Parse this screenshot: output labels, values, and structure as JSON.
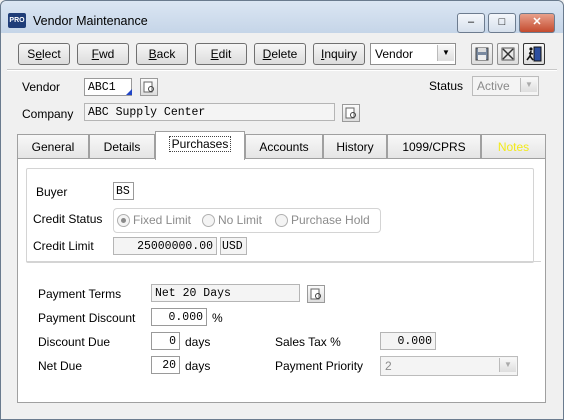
{
  "window": {
    "title": "Vendor Maintenance",
    "app_icon": "PRO",
    "minimize_glyph": "‒",
    "maximize_glyph": "□",
    "close_glyph": "✕"
  },
  "toolbar": {
    "buttons": [
      {
        "pre": "S",
        "u": "e",
        "post": "lect"
      },
      {
        "pre": "",
        "u": "F",
        "post": "wd"
      },
      {
        "pre": "",
        "u": "B",
        "post": "ack"
      },
      {
        "pre": "",
        "u": "E",
        "post": "dit"
      },
      {
        "pre": "",
        "u": "D",
        "post": "elete"
      },
      {
        "pre": "",
        "u": "I",
        "post": "nquiry"
      }
    ],
    "mode_select": "Vendor"
  },
  "header": {
    "vendor_label": "Vendor",
    "vendor_value": "ABC1",
    "company_label": "Company",
    "company_value": "ABC Supply Center",
    "status_label": "Status",
    "status_value": "Active"
  },
  "tabs": [
    {
      "label": "General",
      "active": false
    },
    {
      "label": "Details",
      "active": false
    },
    {
      "label": "Purchases",
      "active": true
    },
    {
      "label": "Accounts",
      "active": false
    },
    {
      "label": "History",
      "active": false
    },
    {
      "label": "1099/CPRS",
      "active": false
    },
    {
      "label": "Notes",
      "active": false
    }
  ],
  "colors": {
    "notes_tab_text": "#f2ea1a"
  },
  "purchases": {
    "buyer_label": "Buyer",
    "buyer_value": "BS",
    "credit_status_label": "Credit Status",
    "credit_options": [
      "Fixed Limit",
      "No Limit",
      "Purchase Hold"
    ],
    "credit_selected": "Fixed Limit",
    "credit_limit_label": "Credit Limit",
    "credit_limit_value": "25000000.00",
    "credit_currency": "USD",
    "payment_terms_label": "Payment Terms",
    "payment_terms_value": "Net 20 Days",
    "payment_discount_label": "Payment Discount",
    "payment_discount_value": "0.000",
    "percent_sign": "%",
    "discount_due_label": "Discount Due",
    "discount_due_value": "0",
    "days_unit": "days",
    "net_due_label": "Net Due",
    "net_due_value": "20",
    "sales_tax_label": "Sales Tax %",
    "sales_tax_value": "0.000",
    "payment_priority_label": "Payment Priority",
    "payment_priority_value": "2"
  }
}
